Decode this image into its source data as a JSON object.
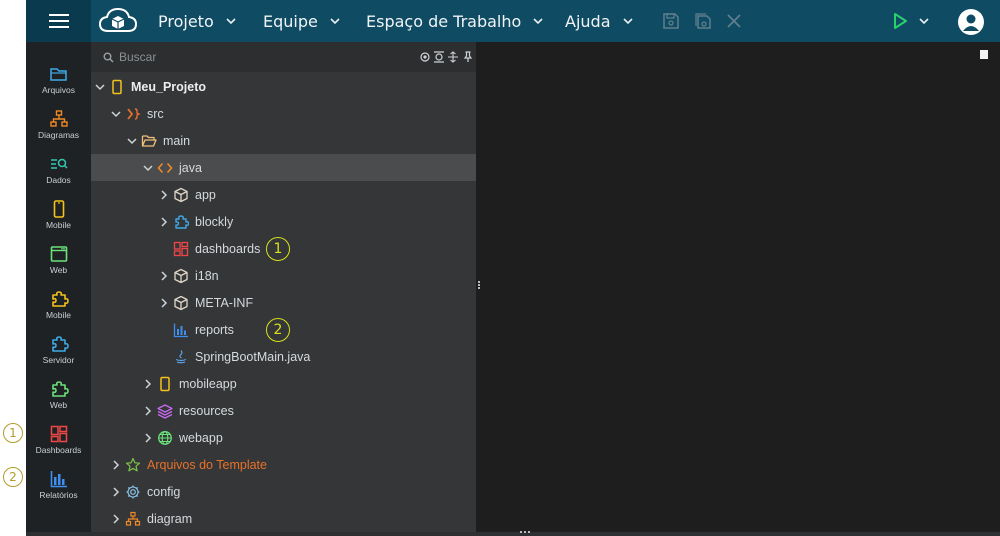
{
  "topbar": {
    "menus": [
      {
        "label": "Projeto"
      },
      {
        "label": "Equipe"
      },
      {
        "label": "Espaço de Trabalho"
      },
      {
        "label": "Ajuda"
      }
    ],
    "accent": "#0f4b63"
  },
  "activity_bar": {
    "items": [
      {
        "label": "Arquivos",
        "icon": "folder-icon"
      },
      {
        "label": "Diagramas",
        "icon": "diagram-icon"
      },
      {
        "label": "Dados",
        "icon": "data-icon"
      },
      {
        "label": "Mobile",
        "icon": "mobile-icon"
      },
      {
        "label": "Web",
        "icon": "web-icon"
      },
      {
        "label": "Mobile",
        "icon": "puzzle-icon"
      },
      {
        "label": "Servidor",
        "icon": "puzzle-icon"
      },
      {
        "label": "Web",
        "icon": "puzzle-icon"
      },
      {
        "label": "Dashboards",
        "icon": "dashboard-icon"
      },
      {
        "label": "Relatórios",
        "icon": "report-icon"
      }
    ]
  },
  "callouts": {
    "one": "1",
    "two": "2"
  },
  "explorer": {
    "search_placeholder": "Buscar",
    "tree": [
      {
        "label": "Meu_Projeto",
        "icon": "mobile-icon"
      },
      {
        "label": "src",
        "icon": "source-icon"
      },
      {
        "label": "main",
        "icon": "folder-open-icon"
      },
      {
        "label": "java",
        "icon": "code-icon"
      },
      {
        "label": "app",
        "icon": "package-icon"
      },
      {
        "label": "blockly",
        "icon": "puzzle-icon"
      },
      {
        "label": "dashboards",
        "icon": "dashboard-icon"
      },
      {
        "label": "i18n",
        "icon": "package-icon"
      },
      {
        "label": "META-INF",
        "icon": "package-icon"
      },
      {
        "label": "reports",
        "icon": "report-icon"
      },
      {
        "label": "SpringBootMain.java",
        "icon": "java-icon"
      },
      {
        "label": "mobileapp",
        "icon": "mobile-icon"
      },
      {
        "label": "resources",
        "icon": "layers-icon"
      },
      {
        "label": "webapp",
        "icon": "globe-icon"
      },
      {
        "label": "Arquivos do Template",
        "icon": "star-icon"
      },
      {
        "label": "config",
        "icon": "gear-icon"
      },
      {
        "label": "diagram",
        "icon": "diagram-icon"
      }
    ]
  }
}
